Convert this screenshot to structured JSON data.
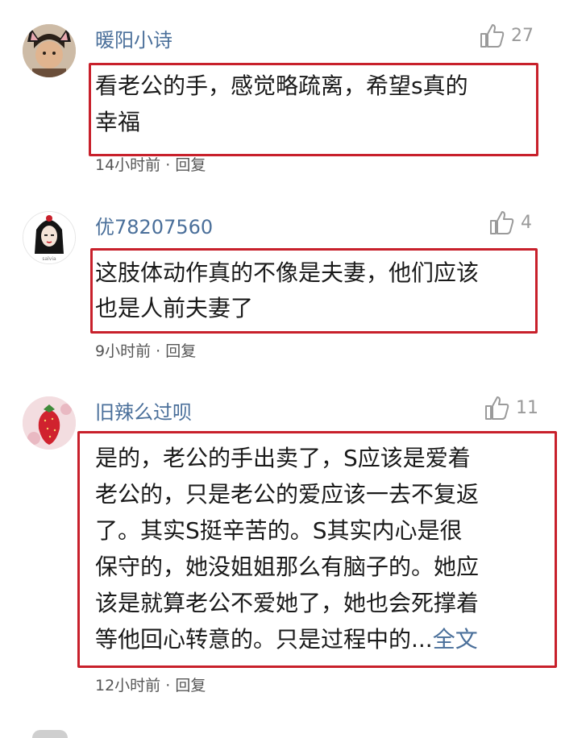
{
  "comments": [
    {
      "username": "暖阳小诗",
      "likes": "27",
      "lines": [
        "看老公的手，感觉略疏离，希望s真的",
        "幸福"
      ],
      "time": "14小时前",
      "reply": "回复",
      "avatar": "cat-ear-selfie-avatar"
    },
    {
      "username": "优78207560",
      "likes": "4",
      "lines": [
        "这肢体动作真的不像是夫妻，他们应该",
        "也是人前夫妻了"
      ],
      "time": "9小时前",
      "reply": "回复",
      "avatar": "girl-illustration-avatar"
    },
    {
      "username": "旧辣么过呗",
      "likes": "11",
      "lines": [
        "是的，老公的手出卖了，S应该是爱着",
        "老公的，只是老公的爱应该一去不复返",
        "了。其实S挺辛苦的。S其实内心是很",
        "保守的，她没姐姐那么有脑子的。她应",
        "该是就算老公不爱她了，她也会死撑着",
        "等他回心转意的。只是过程中的..."
      ],
      "expand": "全文",
      "time": "12小时前",
      "reply": "回复",
      "avatar": "strawberry-avatar"
    }
  ],
  "separator": "·",
  "colors": {
    "highlight_border": "#c8202b",
    "username": "#4a6f9a",
    "meta": "#555555",
    "like": "#9a9a9a"
  },
  "icons": [
    "thumbs-up-icon"
  ]
}
